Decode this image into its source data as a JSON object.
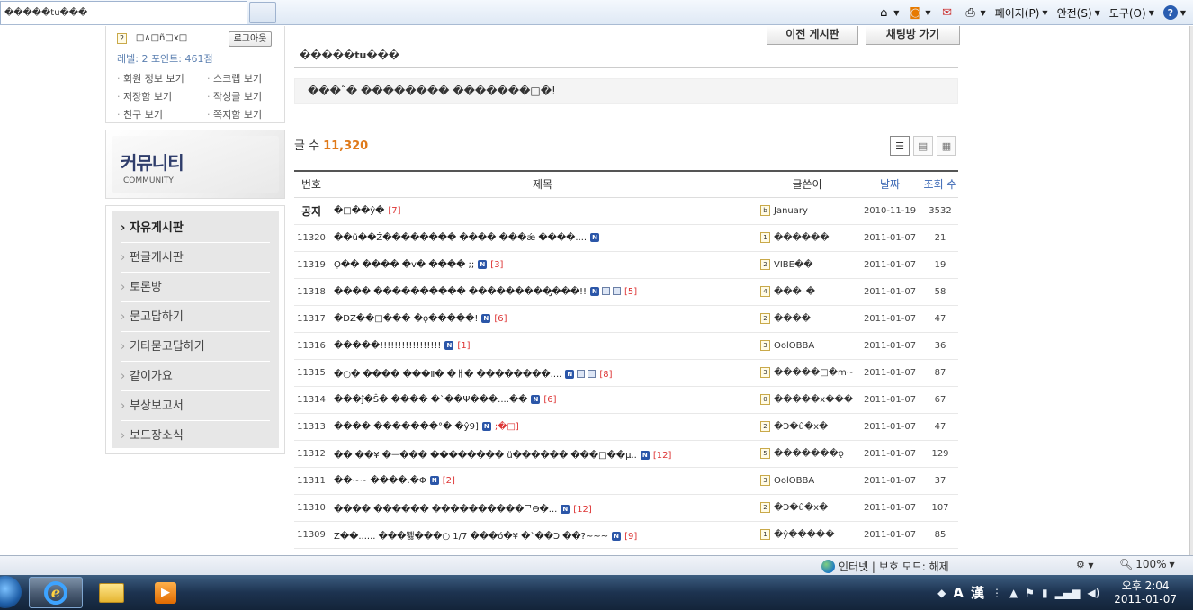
{
  "browser": {
    "tab_title": "�����tu���",
    "commands": {
      "page": "페이지(P)",
      "safety": "안전(S)",
      "tools": "도구(O)"
    }
  },
  "user": {
    "level_badge": "2",
    "name": "□∧□ñ□x□",
    "logout_label": "로그아웃",
    "level_text": "레벨: 2  포인트: 461점",
    "links": [
      "회원 정보 보기",
      "스크랩 보기",
      "저장함 보기",
      "작성글 보기",
      "친구 보기",
      "쪽지함 보기"
    ]
  },
  "community": {
    "title": "커뮤니티",
    "subtitle": "COMMUNITY"
  },
  "board_menu": [
    "자유게시판",
    "펀글게시판",
    "토론방",
    "묻고답하기",
    "기타묻고답하기",
    "같이가요",
    "부상보고서",
    "보드장소식"
  ],
  "top_buttons": {
    "prev": "이전 게시판",
    "chat": "채팅방 가기"
  },
  "board": {
    "tab_title": "�����tu���",
    "notice_text": "���˜� �������� �������□�!",
    "count_label": "글 수",
    "count_value": "11,320",
    "headers": {
      "no": "번호",
      "title": "제목",
      "author": "글쓴이",
      "date": "날짜",
      "views": "조회 수"
    },
    "rows": [
      {
        "no": "공지",
        "title": "�□��ŷ�",
        "comments": "[7]",
        "badge": "b",
        "author": "January",
        "date": "2010-11-19",
        "views": "3532"
      },
      {
        "no": "11320",
        "title": "��ũ��Ż�������� ���� ���ǽ ����....",
        "comments": "",
        "badge": "1",
        "author": "������",
        "date": "2011-01-07",
        "views": "21"
      },
      {
        "no": "11319",
        "title": "Ọ�� ���� �v� ���� ;;",
        "comments": "[3]",
        "badge": "2",
        "author": "VIBE��",
        "date": "2011-01-07",
        "views": "19"
      },
      {
        "no": "11318",
        "title": "���� ���������� ���������̡���!!",
        "comments": "[5]",
        "badge": "4",
        "author": "���–�",
        "date": "2011-01-07",
        "views": "58"
      },
      {
        "no": "11317",
        "title": "�DZ��□��� �ǫ�����!",
        "comments": "[6]",
        "badge": "2",
        "author": "����",
        "date": "2011-01-07",
        "views": "47"
      },
      {
        "no": "11316",
        "title": "�����!!!!!!!!!!!!!!!!!",
        "comments": "[1]",
        "badge": "3",
        "author": "OolOBBA",
        "date": "2011-01-07",
        "views": "36"
      },
      {
        "no": "11315",
        "title": "�○� ���� ���Ⅱ� �ㅐ� ��������....",
        "comments": "[8]",
        "badge": "3",
        "author": "�����□�m~",
        "date": "2011-01-07",
        "views": "87"
      },
      {
        "no": "11314",
        "title": "���ĵ�Ŝ� ���� �ˋ��Ψ���....��",
        "comments": "[6]",
        "badge": "0",
        "author": "�����x���",
        "date": "2011-01-07",
        "views": "67"
      },
      {
        "no": "11313",
        "title": "���� �������°� �ŷ9]",
        "comments": ";�□]",
        "badge": "2",
        "author": "�Ͻ�û�x�",
        "date": "2011-01-07",
        "views": "47"
      },
      {
        "no": "11312",
        "title": "�� ��¥ �ᅳ��� �������� ü������ ���□��µ..",
        "comments": "[12]",
        "badge": "5",
        "author": "�������ǫ",
        "date": "2011-01-07",
        "views": "129"
      },
      {
        "no": "11311",
        "title": "��~~ ����.�Φ",
        "comments": "[2]",
        "badge": "3",
        "author": "OolOBBA",
        "date": "2011-01-07",
        "views": "37"
      },
      {
        "no": "11310",
        "title": "���� ������ ����������ᄀϴ�...",
        "comments": "[12]",
        "badge": "2",
        "author": "�Ͻ�û�x�",
        "date": "2011-01-07",
        "views": "107"
      },
      {
        "no": "11309",
        "title": "Z��...... ���뾇���○ 1/7 ���ó�¥ �ˋ��Ͻ ��?~~~",
        "comments": "[9]",
        "badge": "1",
        "author": "�ŷ�����",
        "date": "2011-01-07",
        "views": "85"
      }
    ]
  },
  "status_bar": {
    "zone": "인터넷 | 보호 모드: 해제",
    "zoom": "100%"
  },
  "taskbar": {
    "ime_a": "A",
    "ime_han": "漢",
    "time": "오후 2:04",
    "date": "2011-01-07"
  }
}
